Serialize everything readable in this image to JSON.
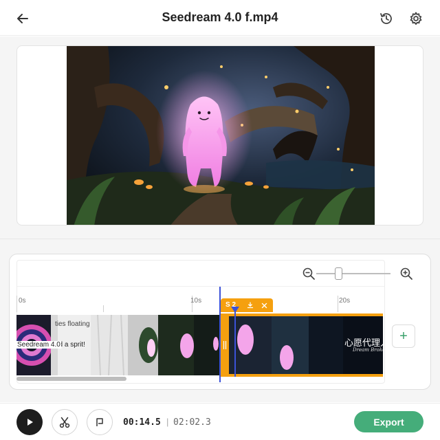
{
  "header": {
    "title": "Seedream 4.0 f.mp4",
    "back_icon": "arrow-left-icon",
    "history_icon": "history-icon",
    "settings_icon": "gear-icon"
  },
  "preview": {
    "scene": "cartoon-ghost-in-enchanted-forest"
  },
  "timeline": {
    "ruler_labels": [
      "0s",
      "10s",
      "20s"
    ],
    "clips": [
      {
        "text_line1": "ties floating",
        "text_line2": "ed a sprit!"
      },
      {
        "text_line1": "Seedream 4.0"
      }
    ],
    "selected_clip": {
      "label": "S 2",
      "download_icon": "download-icon",
      "close_icon": "close-icon"
    },
    "end_clip_text": "心愿代理人",
    "end_clip_subtext": "Dream Broker",
    "add_label": "+"
  },
  "controls": {
    "current_time": "00:14.5",
    "separator": "|",
    "total_time": "02:02.3",
    "export_label": "Export"
  },
  "colors": {
    "accent_orange": "#f5a00f",
    "playhead_blue": "#3b52d8",
    "export_green": "#45ad7a"
  }
}
